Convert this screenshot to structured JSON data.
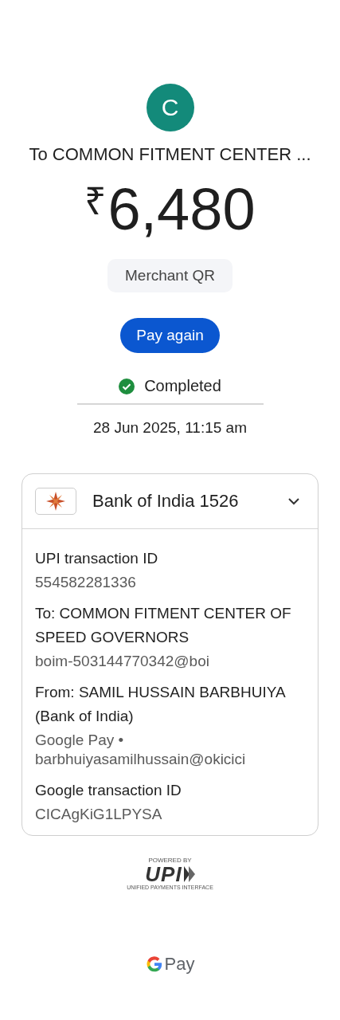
{
  "avatar": {
    "letter": "C",
    "color": "#138a7a"
  },
  "recipient": "To COMMON FITMENT CENTER ...",
  "amount": {
    "currency": "₹",
    "value": "6,480"
  },
  "tag": "Merchant QR",
  "pay_again": "Pay again",
  "status": {
    "kind": "completed",
    "label": "Completed"
  },
  "datetime": "28 Jun 2025, 11:15 am",
  "account": {
    "name": "Bank of India 1526",
    "expanded": true
  },
  "details": [
    {
      "label": "UPI transaction ID",
      "lines": [
        "554582281336"
      ]
    },
    {
      "label": "To: COMMON FITMENT CENTER OF SPEED GOVERNORS",
      "lines": [
        "boim-503144770342@boi"
      ]
    },
    {
      "label": "From: SAMIL HUSSAIN BARBHUIYA (Bank of India)",
      "lines": [
        "Google Pay •",
        "barbhuiyasamilhussain@okicici"
      ]
    },
    {
      "label": "Google transaction ID",
      "lines": [
        "CICAgKiG1LPYSA"
      ]
    }
  ],
  "upi_logo": {
    "top": "POWERED BY",
    "mark": "UPI",
    "bottom": "UNIFIED PAYMENTS INTERFACE"
  },
  "footer_brand": "Pay"
}
